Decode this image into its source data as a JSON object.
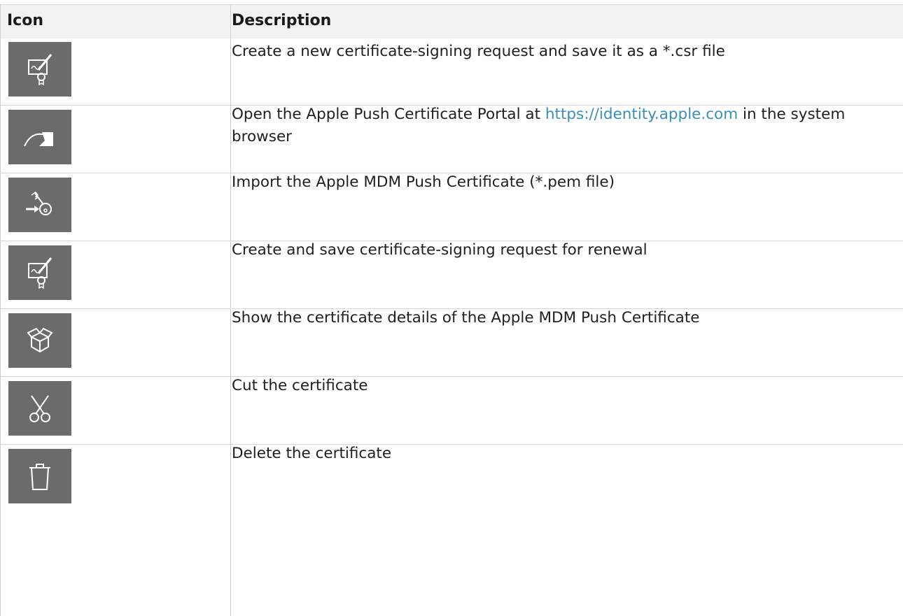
{
  "table": {
    "headers": {
      "icon": "Icon",
      "description": "Description"
    },
    "rows": [
      {
        "icon": "certificate-sign-icon",
        "description": "Create a new certificate-signing request and save it as a *.csr file"
      },
      {
        "icon": "redirect-arrow-icon",
        "description_before": "Open the Apple Push Certificate Portal at ",
        "link_text": "https://identity.apple.com",
        "description_after": " in the system browser"
      },
      {
        "icon": "import-key-icon",
        "description": "Import the Apple MDM Push Certificate (*.pem file)"
      },
      {
        "icon": "certificate-sign-icon",
        "description": "Create and save certificate-signing request for renewal"
      },
      {
        "icon": "open-box-icon",
        "description": "Show the certificate details of the Apple MDM Push Certificate"
      },
      {
        "icon": "scissors-icon",
        "description": "Cut the certificate"
      },
      {
        "icon": "trash-icon",
        "description": "Delete the certificate"
      }
    ]
  },
  "colors": {
    "icon_background": "#6b6b6b",
    "header_background": "#f2f2f2",
    "link": "#3a8fb7"
  }
}
